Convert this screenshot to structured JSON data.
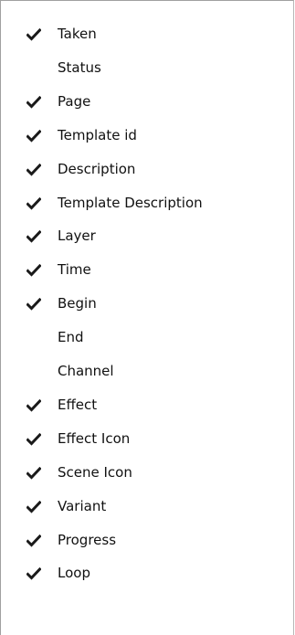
{
  "menu": {
    "items": [
      {
        "label": "Taken",
        "checked": true
      },
      {
        "label": "Status",
        "checked": false
      },
      {
        "label": "Page",
        "checked": true
      },
      {
        "label": "Template id",
        "checked": true
      },
      {
        "label": "Description",
        "checked": true
      },
      {
        "label": "Template Description",
        "checked": true
      },
      {
        "label": "Layer",
        "checked": true
      },
      {
        "label": "Time",
        "checked": true
      },
      {
        "label": "Begin",
        "checked": true
      },
      {
        "label": "End",
        "checked": false
      },
      {
        "label": "Channel",
        "checked": false
      },
      {
        "label": "Effect",
        "checked": true
      },
      {
        "label": "Effect Icon",
        "checked": true
      },
      {
        "label": "Scene Icon",
        "checked": true
      },
      {
        "label": "Variant",
        "checked": true
      },
      {
        "label": "Progress",
        "checked": true
      },
      {
        "label": "Loop",
        "checked": true
      }
    ]
  }
}
